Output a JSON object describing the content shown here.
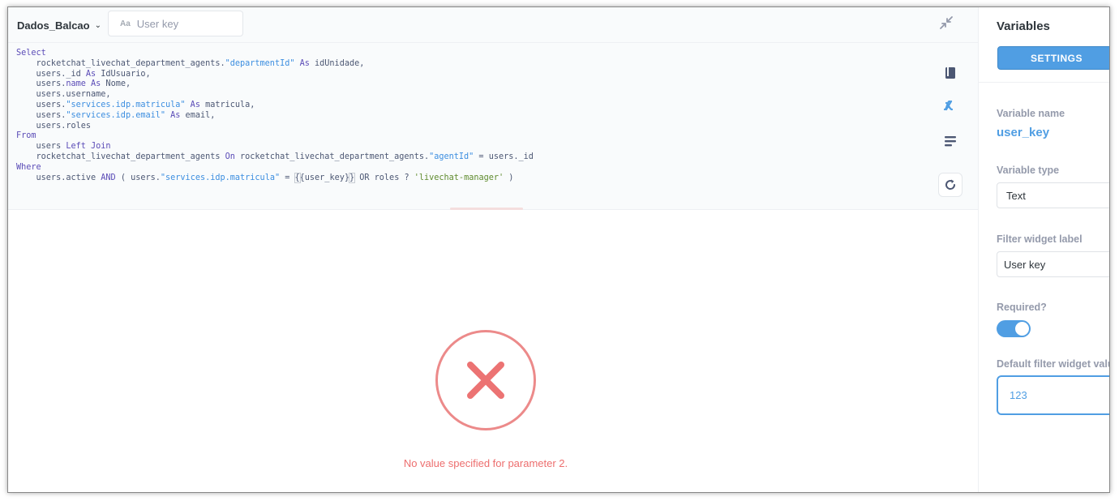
{
  "topbar": {
    "database_name": "Dados_Balcao",
    "variable_widget_placeholder": "User key",
    "variable_widget_icon": "Aa"
  },
  "editor": {
    "lines": [
      [
        {
          "t": "Select",
          "c": "kw"
        }
      ],
      [
        {
          "t": "    rocketchat_livechat_department_agents.",
          "c": ""
        },
        {
          "t": "\"departmentId\"",
          "c": "str"
        },
        {
          "t": " As",
          "c": "kw"
        },
        {
          "t": " idUnidade,",
          "c": ""
        }
      ],
      [
        {
          "t": "    users._id",
          "c": ""
        },
        {
          "t": " As",
          "c": "kw"
        },
        {
          "t": " IdUsuario,",
          "c": ""
        }
      ],
      [
        {
          "t": "    users.",
          "c": ""
        },
        {
          "t": "name",
          "c": "kw"
        },
        {
          "t": " As",
          "c": "kw"
        },
        {
          "t": " Nome,",
          "c": ""
        }
      ],
      [
        {
          "t": "    users.username,",
          "c": ""
        }
      ],
      [
        {
          "t": "    users.",
          "c": ""
        },
        {
          "t": "\"services.idp.matricula\"",
          "c": "str"
        },
        {
          "t": " As",
          "c": "kw"
        },
        {
          "t": " matricula,",
          "c": ""
        }
      ],
      [
        {
          "t": "    users.",
          "c": ""
        },
        {
          "t": "\"services.idp.email\"",
          "c": "str"
        },
        {
          "t": " As",
          "c": "kw"
        },
        {
          "t": " email,",
          "c": ""
        }
      ],
      [
        {
          "t": "    users.roles",
          "c": ""
        }
      ],
      [
        {
          "t": "From",
          "c": "kw"
        }
      ],
      [
        {
          "t": "    users",
          "c": ""
        },
        {
          "t": " Left Join",
          "c": "kw"
        }
      ],
      [
        {
          "t": "    rocketchat_livechat_department_agents",
          "c": ""
        },
        {
          "t": " On",
          "c": "kw"
        },
        {
          "t": " rocketchat_livechat_department_agents.",
          "c": ""
        },
        {
          "t": "\"agentId\"",
          "c": "str"
        },
        {
          "t": " = users._id",
          "c": ""
        }
      ],
      [
        {
          "t": "Where",
          "c": "kw"
        }
      ],
      [
        {
          "t": "    users.active",
          "c": ""
        },
        {
          "t": " AND",
          "c": "kw"
        },
        {
          "t": " ( users.",
          "c": ""
        },
        {
          "t": "\"services.idp.matricula\"",
          "c": "str"
        },
        {
          "t": " = ",
          "c": ""
        },
        {
          "t": "{",
          "c": "tag-hl"
        },
        {
          "t": "{user_key}",
          "c": ""
        },
        {
          "t": "}",
          "c": "tag-hl"
        },
        {
          "t": " OR roles ? ",
          "c": ""
        },
        {
          "t": "'livechat-manager'",
          "c": "lit"
        },
        {
          "t": " )",
          "c": ""
        }
      ]
    ]
  },
  "result": {
    "error_message": "No value specified for parameter 2."
  },
  "sidebar": {
    "title": "Variables",
    "settings_button": "SETTINGS",
    "variable_name_label": "Variable name",
    "variable_name_value": "user_key",
    "variable_type_label": "Variable type",
    "variable_type_value": "Text",
    "filter_widget_label_label": "Filter widget label",
    "filter_widget_label_value": "User key",
    "required_label": "Required?",
    "required_value": true,
    "default_value_label": "Default filter widget value",
    "default_value": "123"
  },
  "colors": {
    "accent": "#509ee3",
    "error": "#ed6e6e",
    "keyword": "#5b4cb7",
    "string": "#3c8ee0",
    "literal": "#5f8b2e"
  },
  "icons": [
    "chevron-down-icon",
    "collapse-icon",
    "data-reference-icon",
    "variables-icon",
    "snippets-icon",
    "refresh-icon",
    "error-x-icon"
  ]
}
